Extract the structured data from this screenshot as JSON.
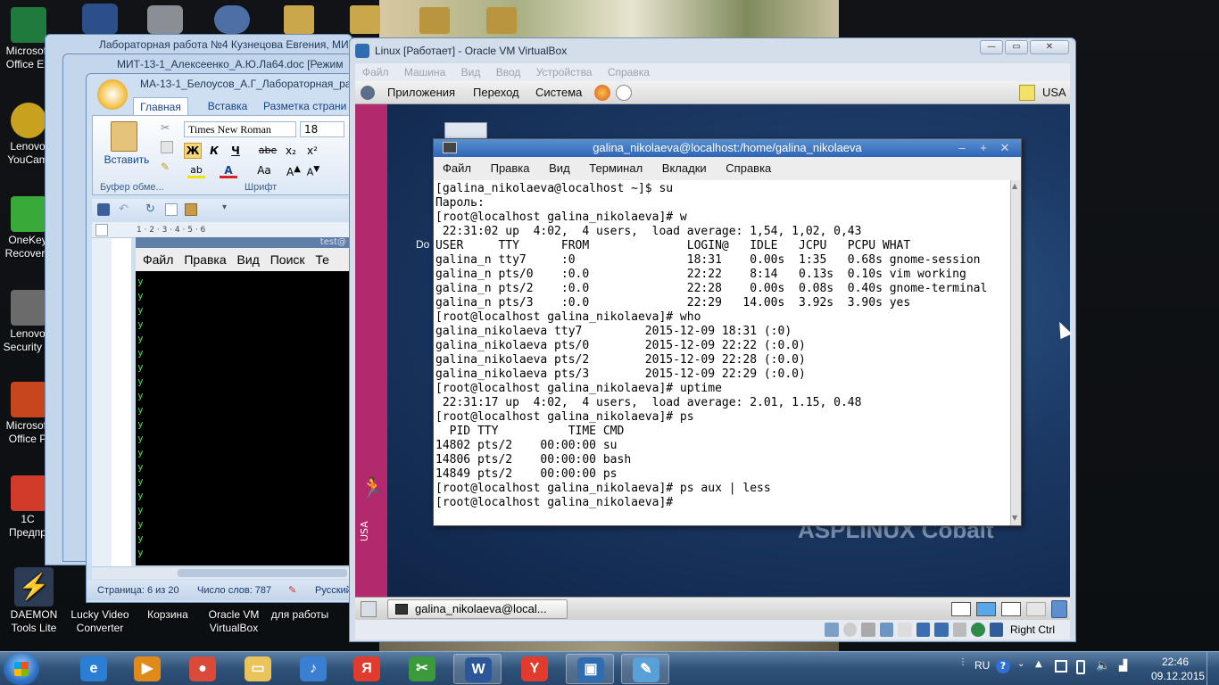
{
  "desktop": {
    "icons": [
      {
        "label": "DAEMON Tools Lite",
        "id": "daemon"
      },
      {
        "label": "Lucky Video Converter",
        "id": "lucky"
      },
      {
        "label": "Корзина",
        "id": "trash"
      },
      {
        "label": "Oracle VM VirtualBox",
        "id": "vbox"
      },
      {
        "label": "для работы",
        "id": "work"
      }
    ],
    "partial_icons": [
      {
        "label1": "Microsoft",
        "label2": "Office Ex",
        "color": "#1e7a3d"
      },
      {
        "label1": "Lenovo",
        "label2": "YouCam",
        "color": "#c8a21e"
      },
      {
        "label1": "OneKey",
        "label2": "Recovery",
        "color": "#39a939"
      },
      {
        "label1": "Lenovo",
        "label2": "Security S",
        "color": "#6b6b6b"
      },
      {
        "label1": "Microsoft",
        "label2": "Office P",
        "color": "#c8461e"
      },
      {
        "label1": "1С",
        "label2": "Предпр",
        "color": "#d23a2a"
      }
    ],
    "partial_label": "Do"
  },
  "word_windows": {
    "back_title": "Лабораторная работа №4 Кузнецова Евгения, МИТ",
    "mid_title": "МИТ-13-1_Алексеенко_А.Ю.Ла64.doc [Режим",
    "front_title": "МА-13-1_Белоусов_А.Г_Лабораторная_раб",
    "tabs": [
      "Главная",
      "Вставка",
      "Разметка страни"
    ],
    "paste_label": "Вставить",
    "font_name": "Times New Roman",
    "font_size": "18",
    "group_clipboard": "Буфер обме...",
    "group_font": "Шрифт",
    "fmt_bold": "Ж",
    "fmt_italic": "К",
    "fmt_underline": "Ч",
    "fmt_strike": "abe",
    "fmt_sub": "x₂",
    "fmt_sup": "x²",
    "ruler_text": "1 · 2 · 3 · 4 · 5 · 6",
    "status_page": "Страница: 6 из 20",
    "status_words": "Число слов: 787",
    "status_lang": "Русский"
  },
  "inner_terminal_menu": [
    "Файл",
    "Правка",
    "Вид",
    "Поиск",
    "Те"
  ],
  "inner_terminal_title": "test@",
  "inner_terminal_lines": [
    "y",
    "y",
    "y",
    "y",
    "y",
    "y",
    "y",
    "y",
    "y",
    "y",
    "y",
    "y",
    "y",
    "y",
    "y",
    "y",
    "y",
    "y",
    "y",
    "y"
  ],
  "vbox": {
    "title": "Linux [Работает] - Oracle VM VirtualBox",
    "menu": [
      "Файл",
      "Машина",
      "Вид",
      "Ввод",
      "Устройства",
      "Справка"
    ],
    "gnome_menu": [
      "Приложения",
      "Переход",
      "Система"
    ],
    "keyboard": "USA",
    "side_label": "USA",
    "watermark": "ASPLINUX Cobalt",
    "taskbar_item": "galina_nikolaeva@local...",
    "host_key": "Right Ctrl"
  },
  "terminal": {
    "title": "galina_nikolaeva@localhost:/home/galina_nikolaeva",
    "menu": [
      "Файл",
      "Правка",
      "Вид",
      "Терминал",
      "Вкладки",
      "Справка"
    ],
    "lines": [
      "[galina_nikolaeva@localhost ~]$ su",
      "Пароль:",
      "[root@localhost galina_nikolaeva]# w",
      " 22:31:02 up  4:02,  4 users,  load average: 1,54, 1,02, 0,43",
      "USER     TTY      FROM              LOGIN@   IDLE   JCPU   PCPU WHAT",
      "galina_n tty7     :0                18:31    0.00s  1:35   0.68s gnome-session",
      "galina_n pts/0    :0.0              22:22    8:14   0.13s  0.10s vim working",
      "galina_n pts/2    :0.0              22:28    0.00s  0.08s  0.40s gnome-terminal",
      "galina_n pts/3    :0.0              22:29   14.00s  3.92s  3.90s yes",
      "[root@localhost galina_nikolaeva]# who",
      "galina_nikolaeva tty7         2015-12-09 18:31 (:0)",
      "galina_nikolaeva pts/0        2015-12-09 22:22 (:0.0)",
      "galina_nikolaeva pts/2        2015-12-09 22:28 (:0.0)",
      "galina_nikolaeva pts/3        2015-12-09 22:29 (:0.0)",
      "[root@localhost galina_nikolaeva]# uptime",
      " 22:31:17 up  4:02,  4 users,  load average: 2.01, 1.15, 0.48",
      "[root@localhost galina_nikolaeva]# ps",
      "  PID TTY          TIME CMD",
      "14802 pts/2    00:00:00 su",
      "14806 pts/2    00:00:00 bash",
      "14849 pts/2    00:00:00 ps",
      "[root@localhost galina_nikolaeva]# ps aux | less",
      "[root@localhost galina_nikolaeva]#"
    ]
  },
  "taskbar": {
    "apps": [
      {
        "name": "ie",
        "color": "#2a7fd4",
        "glyph": "e"
      },
      {
        "name": "media",
        "color": "#e08a1c",
        "glyph": "▶"
      },
      {
        "name": "chrome",
        "color": "#d94a38",
        "glyph": "●"
      },
      {
        "name": "explorer",
        "color": "#e8c45a",
        "glyph": "▭"
      },
      {
        "name": "sound",
        "color": "#3b7fd0",
        "glyph": "♪"
      },
      {
        "name": "yandex",
        "color": "#e03b2c",
        "glyph": "Я"
      },
      {
        "name": "tools",
        "color": "#3c9a3c",
        "glyph": "✂"
      },
      {
        "name": "word",
        "color": "#2b579a",
        "glyph": "W"
      },
      {
        "name": "yandex2",
        "color": "#e03b2c",
        "glyph": "Y"
      },
      {
        "name": "virtualbox",
        "color": "#2f6db0",
        "glyph": "▣"
      },
      {
        "name": "paint",
        "color": "#5aa0d8",
        "glyph": "✎"
      }
    ],
    "lang": "RU",
    "time": "22:46",
    "date": "09.12.2015"
  },
  "colors": {
    "pink": "#b22a6d",
    "term_title": "#2e66b8",
    "word_blue": "#2b579a"
  }
}
